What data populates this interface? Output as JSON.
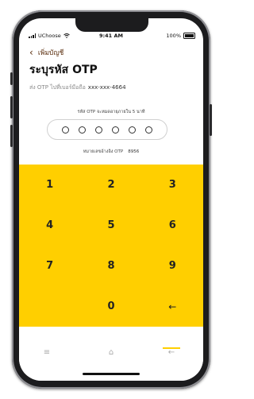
{
  "status_bar": {
    "carrier": "UChoose",
    "time": "9:41 AM",
    "battery": "100%"
  },
  "header": {
    "back_label": "เพิ่มบัญชี",
    "title": "ระบุรหัส OTP"
  },
  "otp": {
    "sent_text": "ส่ง OTP ไปที่เบอร์มือถือ",
    "phone_number": "xxx-xxx-4664",
    "expire_text": "รหัส OTP จะหมดอายุภายใน 5 นาที",
    "ref_label": "หมายเลขอ้างอิง OTP",
    "ref_code": "8956",
    "digits_entered": 0,
    "digits_total": 6
  },
  "keypad": {
    "keys": [
      "1",
      "2",
      "3",
      "4",
      "5",
      "6",
      "7",
      "8",
      "9",
      "",
      "0",
      "←"
    ]
  },
  "nav": {
    "menu_icon": "≡",
    "home_icon": "⌂",
    "back_icon": "←"
  },
  "colors": {
    "accent": "#ffcf00",
    "back_label": "#5a2d0c"
  }
}
